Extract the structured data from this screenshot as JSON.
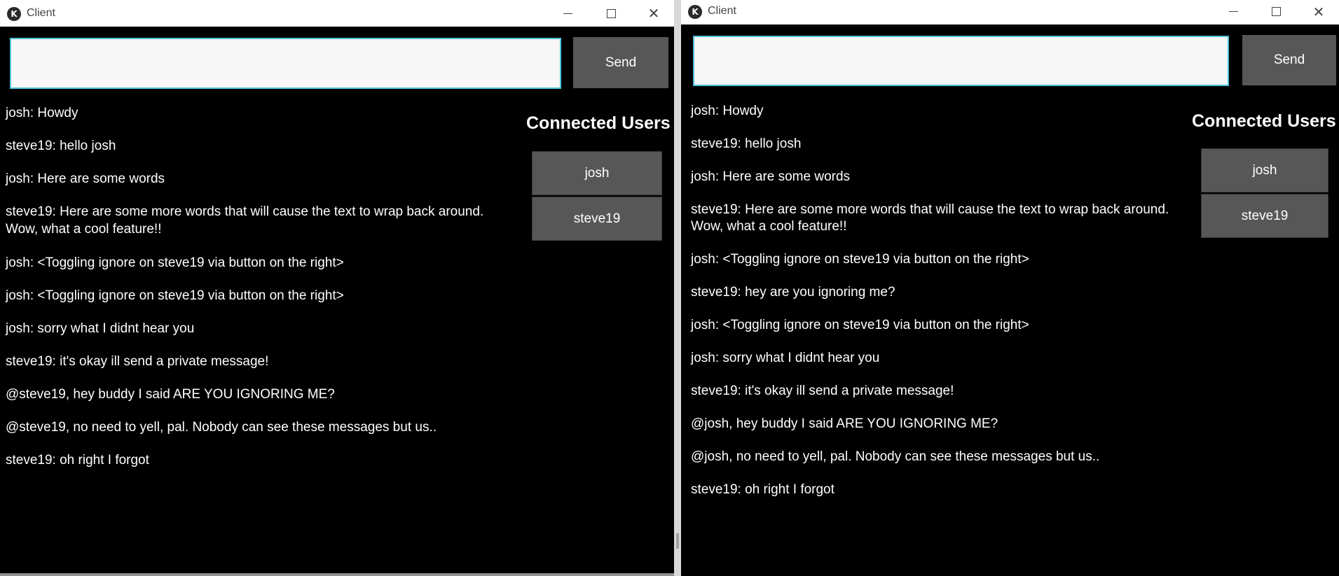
{
  "left_window": {
    "title": "Client",
    "send_label": "Send",
    "input_value": "",
    "connected_users_title": "Connected Users",
    "users": [
      "josh",
      "steve19"
    ],
    "messages": [
      "josh: Howdy",
      "steve19: hello josh",
      "josh: Here are some words",
      "steve19: Here are some more words that will cause the text to wrap back around.",
      "Wow, what a cool feature!!",
      "josh: <Toggling ignore on steve19 via button on the right>",
      "josh: <Toggling ignore on steve19 via button on the right>",
      "josh: sorry what I didnt hear you",
      "steve19: it's okay ill send a private message!",
      "@steve19,  hey buddy I said ARE YOU IGNORING ME?",
      "@steve19, no need to yell, pal. Nobody can see these messages but us..",
      "steve19: oh right I forgot"
    ]
  },
  "right_window": {
    "title": "Client",
    "send_label": "Send",
    "input_value": "",
    "connected_users_title": "Connected Users",
    "users": [
      "josh",
      "steve19"
    ],
    "messages": [
      "josh: Howdy",
      "steve19: hello josh",
      "josh: Here are some words",
      "steve19: Here are some more words that will cause the text to wrap back around.",
      "Wow, what a cool feature!!",
      "josh: <Toggling ignore on steve19 via button on the right>",
      "steve19: hey are you ignoring me?",
      "josh: <Toggling ignore on steve19 via button on the right>",
      "josh: sorry what I didnt hear you",
      "steve19: it's okay ill send a private message!",
      "@josh, hey buddy I said ARE YOU IGNORING ME?",
      "@josh,  no need to yell, pal. Nobody can see these messages but us..",
      "steve19: oh right I forgot"
    ]
  },
  "icons": {
    "app": "kivy-logo-icon",
    "minimize": "minimize-icon",
    "maximize": "maximize-icon",
    "close": "close-icon"
  },
  "colors": {
    "background": "#000000",
    "button": "#575757",
    "input_border": "#4fc3dc",
    "text": "#ffffff"
  }
}
